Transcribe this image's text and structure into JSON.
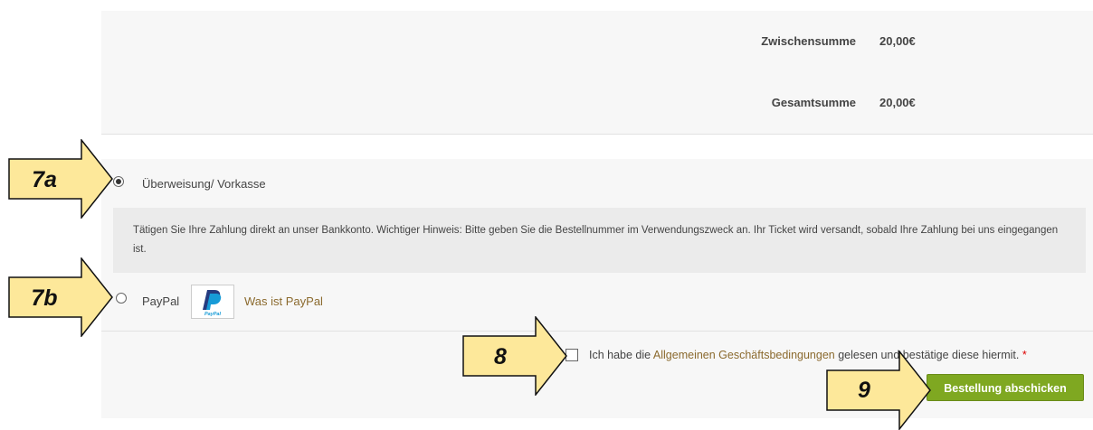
{
  "totals": {
    "subtotal_label": "Zwischensumme",
    "subtotal_value": "20,00€",
    "total_label": "Gesamtsumme",
    "total_value": "20,00€"
  },
  "payment": {
    "bank": {
      "label": "Überweisung/ Vorkasse",
      "selected": true,
      "description": "Tätigen Sie Ihre Zahlung direkt an unser Bankkonto. Wichtiger Hinweis: Bitte geben Sie die Bestellnummer im Verwendungszweck an. Ihr Ticket wird versandt, sobald Ihre Zahlung bei uns eingegangen ist."
    },
    "paypal": {
      "label": "PayPal",
      "selected": false,
      "logo_text": "PayPal",
      "info_link": "Was ist PayPal"
    }
  },
  "terms": {
    "prefix": "Ich habe die ",
    "link": "Allgemeinen Geschäftsbedingungen",
    "suffix": " gelesen und bestätige diese hiermit.",
    "required_mark": "*",
    "checked": false
  },
  "submit_label": "Bestellung abschicken",
  "callouts": {
    "c7a": "7a",
    "c7b": "7b",
    "c8": "8",
    "c9": "9"
  },
  "colors": {
    "callout_fill": "#fde89a",
    "button": "#7fa821",
    "link": "#8b6a2e"
  }
}
